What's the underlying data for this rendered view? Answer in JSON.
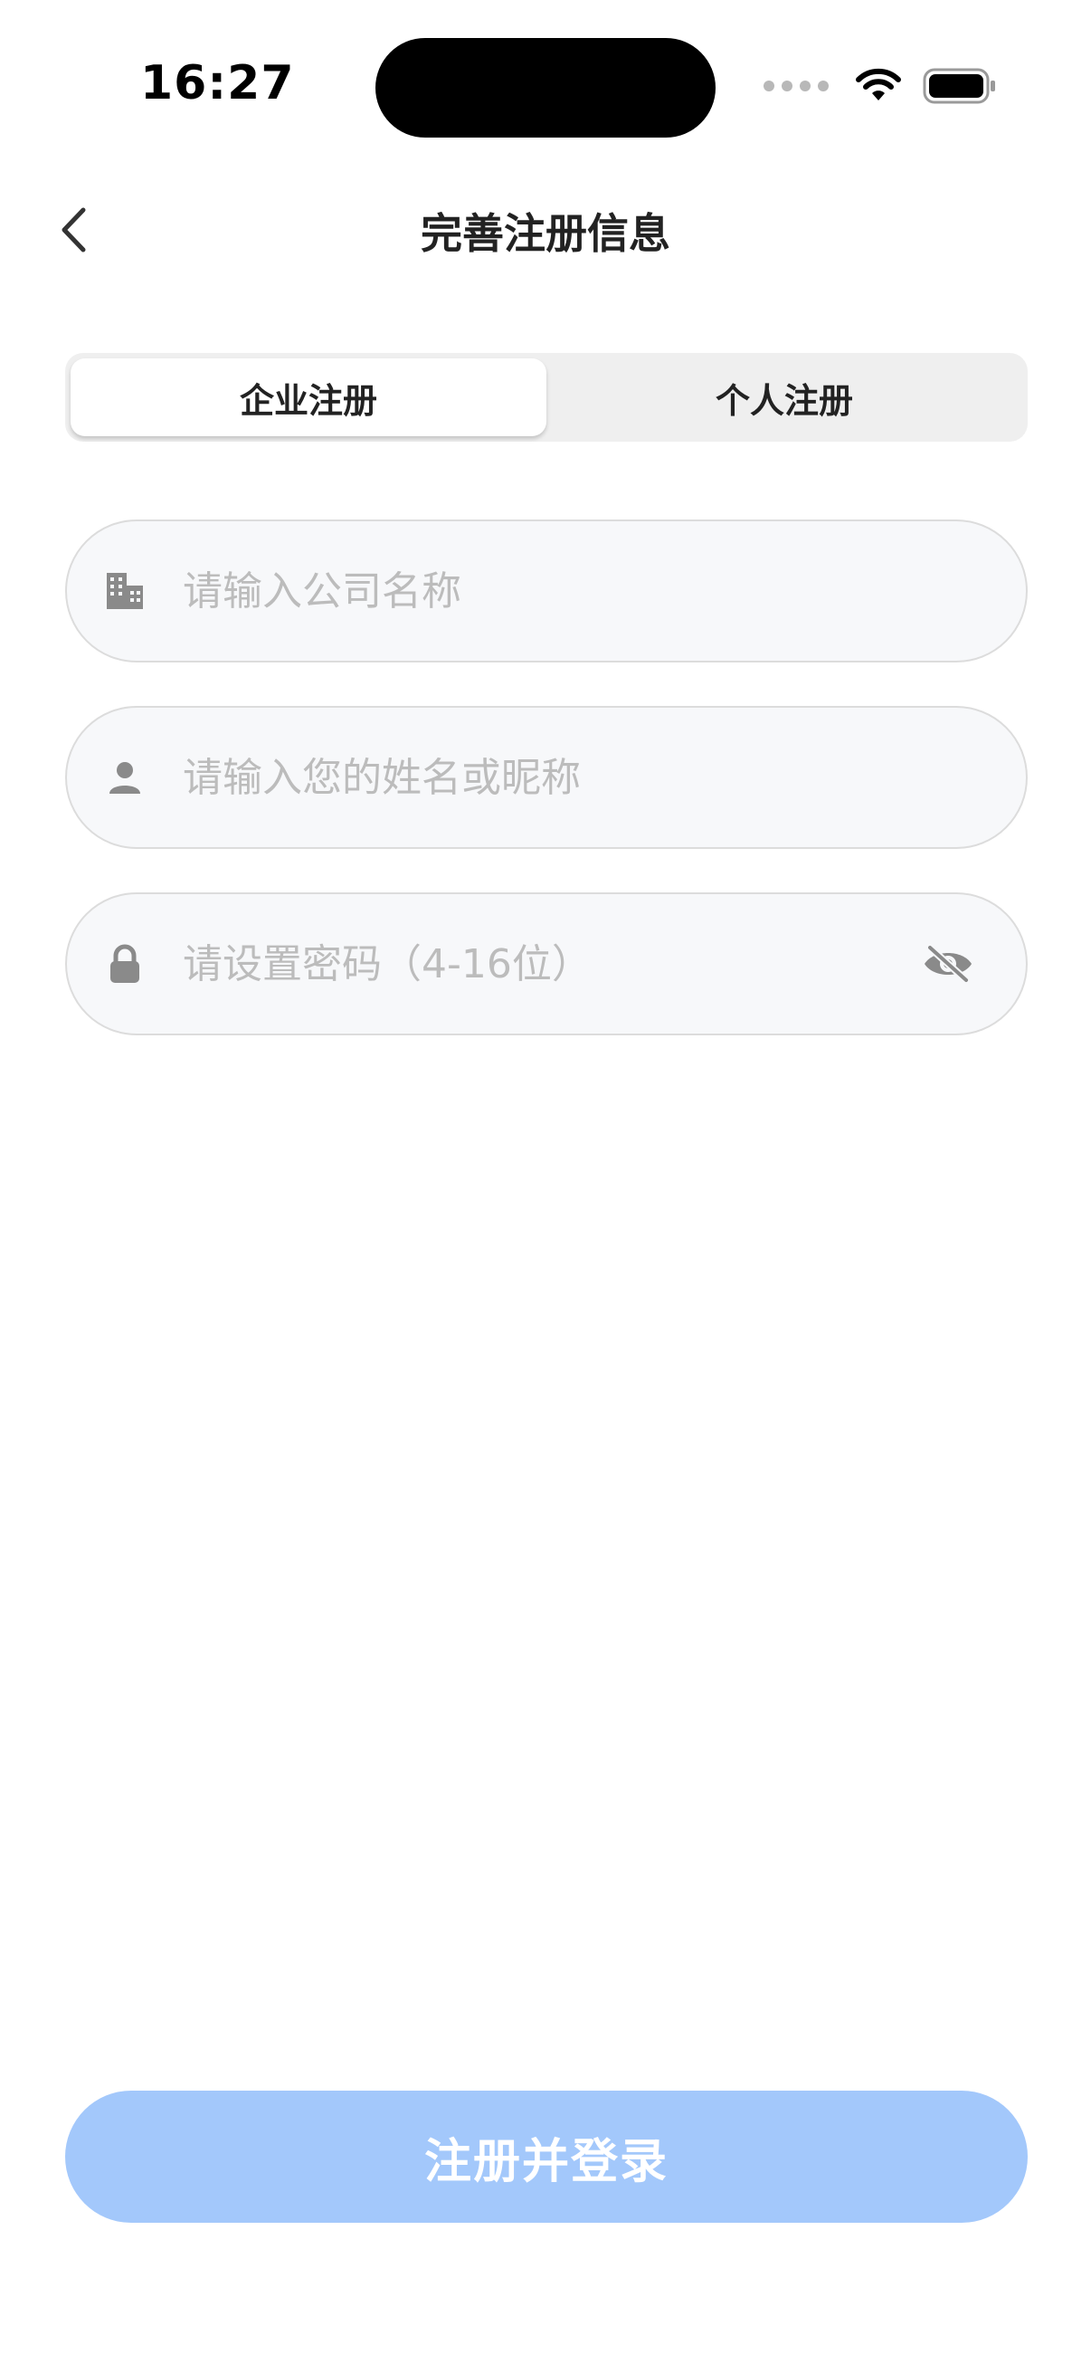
{
  "status_bar": {
    "time": "16:27"
  },
  "header": {
    "title": "完善注册信息"
  },
  "tabs": [
    {
      "label": "企业注册",
      "active": true
    },
    {
      "label": "个人注册",
      "active": false
    }
  ],
  "form": {
    "company": {
      "placeholder": "请输入公司名称",
      "value": "",
      "icon": "building-icon"
    },
    "name": {
      "placeholder": "请输入您的姓名或昵称",
      "value": "",
      "icon": "person-icon"
    },
    "password": {
      "placeholder": "请设置密码（4-16位）",
      "value": "",
      "icon": "lock-icon",
      "toggle_icon": "eye-slash-icon"
    }
  },
  "submit": {
    "label": "注册并登录",
    "enabled": false
  },
  "colors": {
    "accent_disabled": "#a3c8fb",
    "field_bg": "#f7f8fa",
    "icon_gray": "#8a8a8a"
  }
}
